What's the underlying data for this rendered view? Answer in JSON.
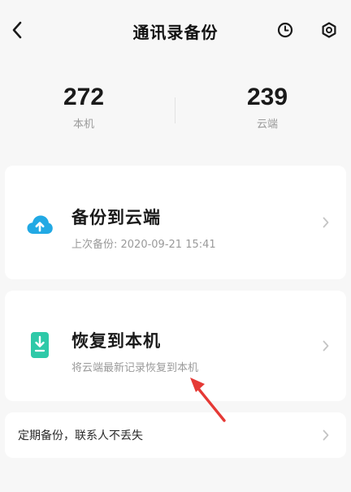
{
  "header": {
    "title": "通讯录备份",
    "back_icon": "chevron-left-icon",
    "history_icon": "clock-icon",
    "settings_icon": "gear-icon"
  },
  "stats": {
    "local": {
      "value": "272",
      "label": "本机"
    },
    "cloud": {
      "value": "239",
      "label": "云端"
    }
  },
  "backup_card": {
    "title": "备份到云端",
    "subtitle": "上次备份: 2020-09-21 15:41",
    "icon": "cloud-upload-icon",
    "icon_color": "#22a9e4"
  },
  "restore_card": {
    "title": "恢复到本机",
    "subtitle": "将云端最新记录恢复到本机",
    "icon": "phone-download-icon",
    "icon_color": "#2ec9a8"
  },
  "schedule_card": {
    "label": "定期备份，联系人不丢失"
  },
  "colors": {
    "background": "#f7f7f7",
    "card": "#ffffff",
    "annotation_arrow": "#e53935"
  }
}
